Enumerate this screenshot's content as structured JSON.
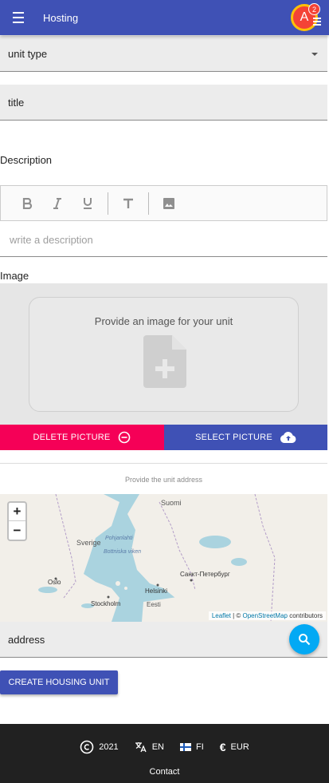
{
  "appbar": {
    "title": "Hosting",
    "menu_icon": "menu-icon",
    "avatar_initial": "A",
    "badge_count": "2",
    "colors": {
      "bar": "#3f51b5",
      "avatar": "#f44336",
      "avatar_ring": "#ffc107"
    }
  },
  "form": {
    "unit_type_label": "unit type",
    "title_label": "title",
    "description_label": "Description",
    "description_placeholder": "write a description",
    "editor_tools": [
      "bold-icon",
      "italic-icon",
      "underline-icon",
      "text-format-icon",
      "image-icon"
    ],
    "image_label": "Image",
    "image_prompt": "Provide an image for your unit",
    "delete_picture": "DELETE PICTURE",
    "select_picture": "SELECT PICTURE",
    "address_hint": "Provide the unit address",
    "address_label": "address",
    "create_button": "CREATE HOUSING UNIT"
  },
  "map": {
    "zoom_in": "+",
    "zoom_out": "−",
    "places": [
      "Suomi",
      "Sverige",
      "Pohjanlahti",
      "Bottniska viken",
      "Oslo",
      "Stockholm",
      "Helsinki",
      "Санкт-Петербург",
      "Eesti"
    ],
    "attribution": {
      "leaflet": "Leaflet",
      "sep": " | © ",
      "osm": "OpenStreetMap",
      "contributors": " contributors"
    }
  },
  "footer": {
    "year": "2021",
    "lang_en": "EN",
    "lang_fi": "FI",
    "currency": "EUR",
    "contact": "Contact"
  },
  "colors": {
    "delete": "#f50057",
    "select": "#3f51b5",
    "fab": "#03a9f4",
    "footer": "#212121"
  }
}
